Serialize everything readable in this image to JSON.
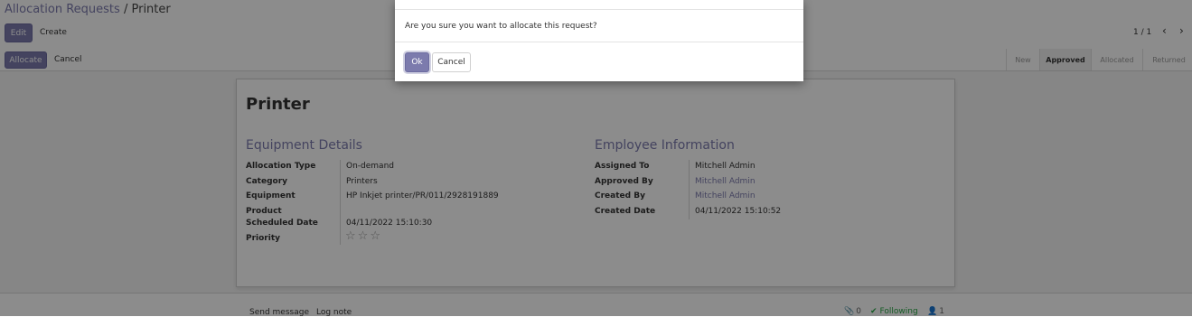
{
  "breadcrumb": {
    "parent": "Allocation Requests",
    "separator": "/",
    "current": "Printer"
  },
  "toolbar": {
    "edit_label": "Edit",
    "create_label": "Create"
  },
  "pager": {
    "value": "1 / 1"
  },
  "statusbar": {
    "allocate_label": "Allocate",
    "cancel_label": "Cancel",
    "stages": [
      {
        "label": "New",
        "active": false
      },
      {
        "label": "Approved",
        "active": true
      },
      {
        "label": "Allocated",
        "active": false
      },
      {
        "label": "Returned",
        "active": false
      }
    ]
  },
  "form": {
    "title": "Printer",
    "equipment_group": {
      "title": "Equipment Details",
      "fields": [
        {
          "label": "Allocation Type",
          "value": "On-demand"
        },
        {
          "label": "Category",
          "value": "Printers"
        },
        {
          "label": "Equipment",
          "value": "HP Inkjet printer/PR/011/2928191889"
        },
        {
          "label": "Product",
          "value": ""
        },
        {
          "label": "Scheduled Date",
          "value": "04/11/2022 15:10:30"
        },
        {
          "label": "Priority",
          "value": ""
        }
      ],
      "priority_stars": 0,
      "priority_max": 3
    },
    "employee_group": {
      "title": "Employee Information",
      "fields": [
        {
          "label": "Assigned To",
          "value": "Mitchell Admin"
        },
        {
          "label": "Approved By",
          "value": "Mitchell Admin"
        },
        {
          "label": "Created By",
          "value": "Mitchell Admin"
        },
        {
          "label": "Created Date",
          "value": "04/11/2022 15:10:52"
        }
      ]
    }
  },
  "chatter": {
    "send_message": "Send message",
    "log_note": "Log note",
    "attachments_count": "0",
    "following_label": "Following",
    "followers_count": "1"
  },
  "modal": {
    "message": "Are you sure you want to allocate this request?",
    "ok_label": "Ok",
    "cancel_label": "Cancel"
  },
  "colors": {
    "brand": "#7c7bad",
    "following": "#28a745"
  }
}
